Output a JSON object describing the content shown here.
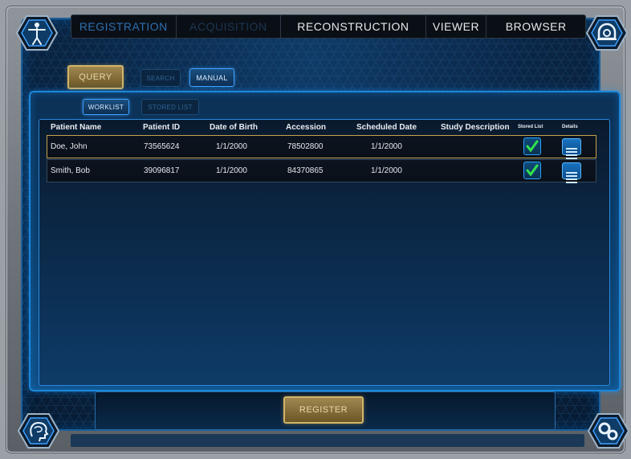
{
  "nav": {
    "tabs": [
      {
        "label": "REGISTRATION",
        "state": "active"
      },
      {
        "label": "ACQUISITION",
        "state": "disabled"
      },
      {
        "label": "RECONSTRUCTION",
        "state": "normal"
      },
      {
        "label": "VIEWER",
        "state": "normal"
      },
      {
        "label": "BROWSER",
        "state": "normal"
      }
    ]
  },
  "toolbar": {
    "query_label": "QUERY",
    "search_label": "SEARCH",
    "manual_label": "MANUAL"
  },
  "subtabs": {
    "worklist_label": "WORKLIST",
    "stored_list_label": "STORED LIST"
  },
  "table": {
    "columns": [
      "Patient Name",
      "Patient ID",
      "Date of Birth",
      "Accession",
      "Scheduled Date",
      "Study Description",
      "Stored List",
      "Details"
    ],
    "rows": [
      {
        "name": "Doe, John",
        "id": "73565624",
        "dob": "1/1/2000",
        "accession": "78502800",
        "scheduled": "1/1/2000",
        "description": "",
        "stored": true
      },
      {
        "name": "Smith, Bob",
        "id": "39096817",
        "dob": "1/1/2000",
        "accession": "84370865",
        "scheduled": "1/1/2000",
        "description": "",
        "stored": true
      }
    ]
  },
  "footer": {
    "register_label": "REGISTER"
  },
  "colors": {
    "accent": "#3ea0ff",
    "gold": "#d2b467",
    "check": "#33e24d"
  },
  "icons": {
    "top_left": "human-figure-icon",
    "top_right": "scanner-icon",
    "bottom_left": "brain-head-icon",
    "bottom_right": "gears-icon"
  }
}
